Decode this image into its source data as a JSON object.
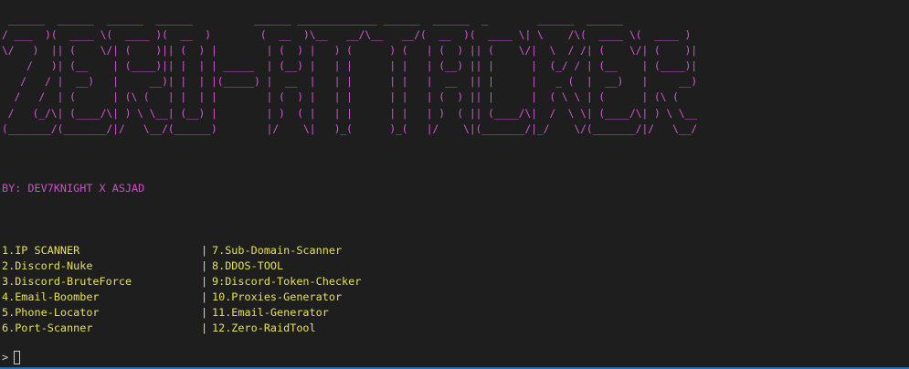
{
  "banner": {
    "ascii": " ______  ______  ______  ______          ______ _____________ ______  ______  _        ______  ______\n/ ___  )(  ____ \\(  ____ )(  __  )        (  __  )\\__   __/\\__   __/(  __  )(  ____ \\| \\    /\\(  ____ \\(  ____ )\n\\/   )  || (    \\/| (    )|| (  ) |        | (  ) |   ) (      ) (   | (  ) || (    \\/|  \\  / /| (    \\/| (    )|\n    /   )| (__    | (____)|| |  | | _____  | (__) |   | |      | |   | (__) || |      |  (_/ / | (__    | (____)|\n   /   / |  __)   |     __)| |  | |(_____) |  __  |   | |      | |   |  __  || |      |   _ (  |  __)   |     __)\n  /   /  | (      | (\\ (   | |  | |        | (  ) |   | |      | |   | (  ) || |      |  ( \\ \\ | (      | (\\ (\n /   (_/\\| (____/\\| ) \\ \\__| (__) |        | )  ( |   | |      | |   | )  ( || (____/\\|  /  \\ \\| (____/\\| ) \\ \\__\n(_______/(_______/|/   \\__/(______)        |/    \\|   )_(      )_(   |/    \\|(_______/|_/    \\/(_______/|/   \\__/",
    "color": "#d957d9"
  },
  "credit": {
    "text": "BY: DEV7KNIGHT X ASJAD",
    "color": "#cc4fcc"
  },
  "menu": {
    "color": "#e6e05a",
    "separator": "|",
    "rows": [
      {
        "left": "1.IP SCANNER",
        "right": "7.Sub-Domain-Scanner"
      },
      {
        "left": "2.Discord-Nuke",
        "right": "8.DDOS-TOOL"
      },
      {
        "left": "3.Discord-BruteForce",
        "right": "9:Discord-Token-Checker"
      },
      {
        "left": "4.Email-Boomber",
        "right": "10.Proxies-Generator"
      },
      {
        "left": "5.Phone-Locator",
        "right": "11.Email-Generator"
      },
      {
        "left": "6.Port-Scanner",
        "right": "12.Zero-RaidTool"
      }
    ]
  },
  "prompt": {
    "symbol": ">",
    "input_value": ""
  },
  "colors": {
    "background": "#1e1e1e",
    "accent_bar": "#2a6aa8"
  }
}
